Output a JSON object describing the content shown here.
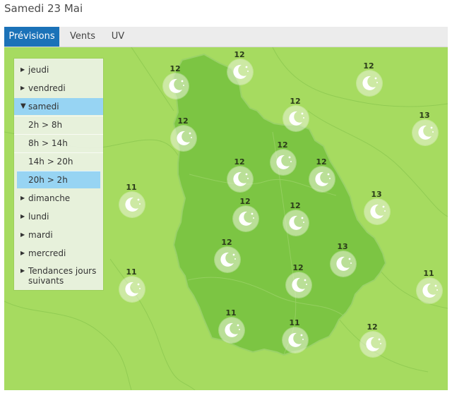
{
  "page": {
    "title": "Samedi 23 Mai"
  },
  "tabs": [
    {
      "label": "Prévisions",
      "active": true
    },
    {
      "label": "Vents",
      "active": false
    },
    {
      "label": "UV",
      "active": false
    }
  ],
  "menu": {
    "days": [
      "jeudi",
      "vendredi",
      "samedi",
      "dimanche",
      "lundi",
      "mardi",
      "mercredi",
      "Tendances jours suivants"
    ],
    "open_day": "samedi",
    "periods": [
      "2h > 8h",
      "8h > 14h",
      "14h > 20h",
      "20h > 2h"
    ],
    "selected_period": "20h > 2h"
  },
  "map": {
    "condition_icon": "moon-stars-icon",
    "colors": {
      "outside": "#a6db60",
      "region": "#7cc543",
      "disc": "#ecf4dc",
      "moon": "#ffffff",
      "selected_menu": "#97d4f3",
      "tab_active": "#1b72b8"
    },
    "temperatures": [
      "12",
      "12",
      "12",
      "12",
      "13",
      "12",
      "12",
      "12",
      "12",
      "11",
      "13",
      "12",
      "12",
      "12",
      "13",
      "12",
      "11",
      "11",
      "11",
      "11",
      "12"
    ]
  }
}
